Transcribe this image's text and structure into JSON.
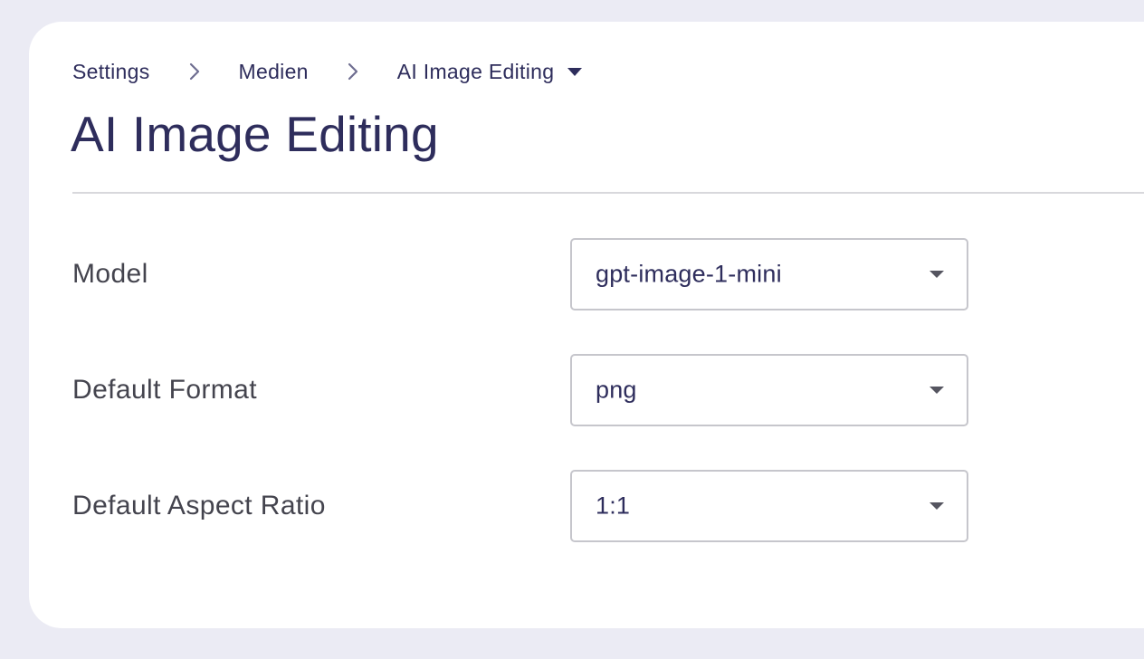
{
  "breadcrumb": {
    "items": [
      {
        "label": "Settings"
      },
      {
        "label": "Medien"
      },
      {
        "label": "AI Image Editing"
      }
    ],
    "separator_icon": "chevron-right-icon",
    "dropdown_icon": "caret-down-icon"
  },
  "page": {
    "title": "AI Image Editing"
  },
  "form": {
    "fields": [
      {
        "label": "Model",
        "value": "gpt-image-1-mini"
      },
      {
        "label": "Default Format",
        "value": "png"
      },
      {
        "label": "Default Aspect Ratio",
        "value": "1:1"
      }
    ]
  },
  "colors": {
    "background": "#ebebf4",
    "card": "#ffffff",
    "primary_text": "#2e2d5c",
    "label_text": "#44444e",
    "border": "#c6c6cc"
  }
}
